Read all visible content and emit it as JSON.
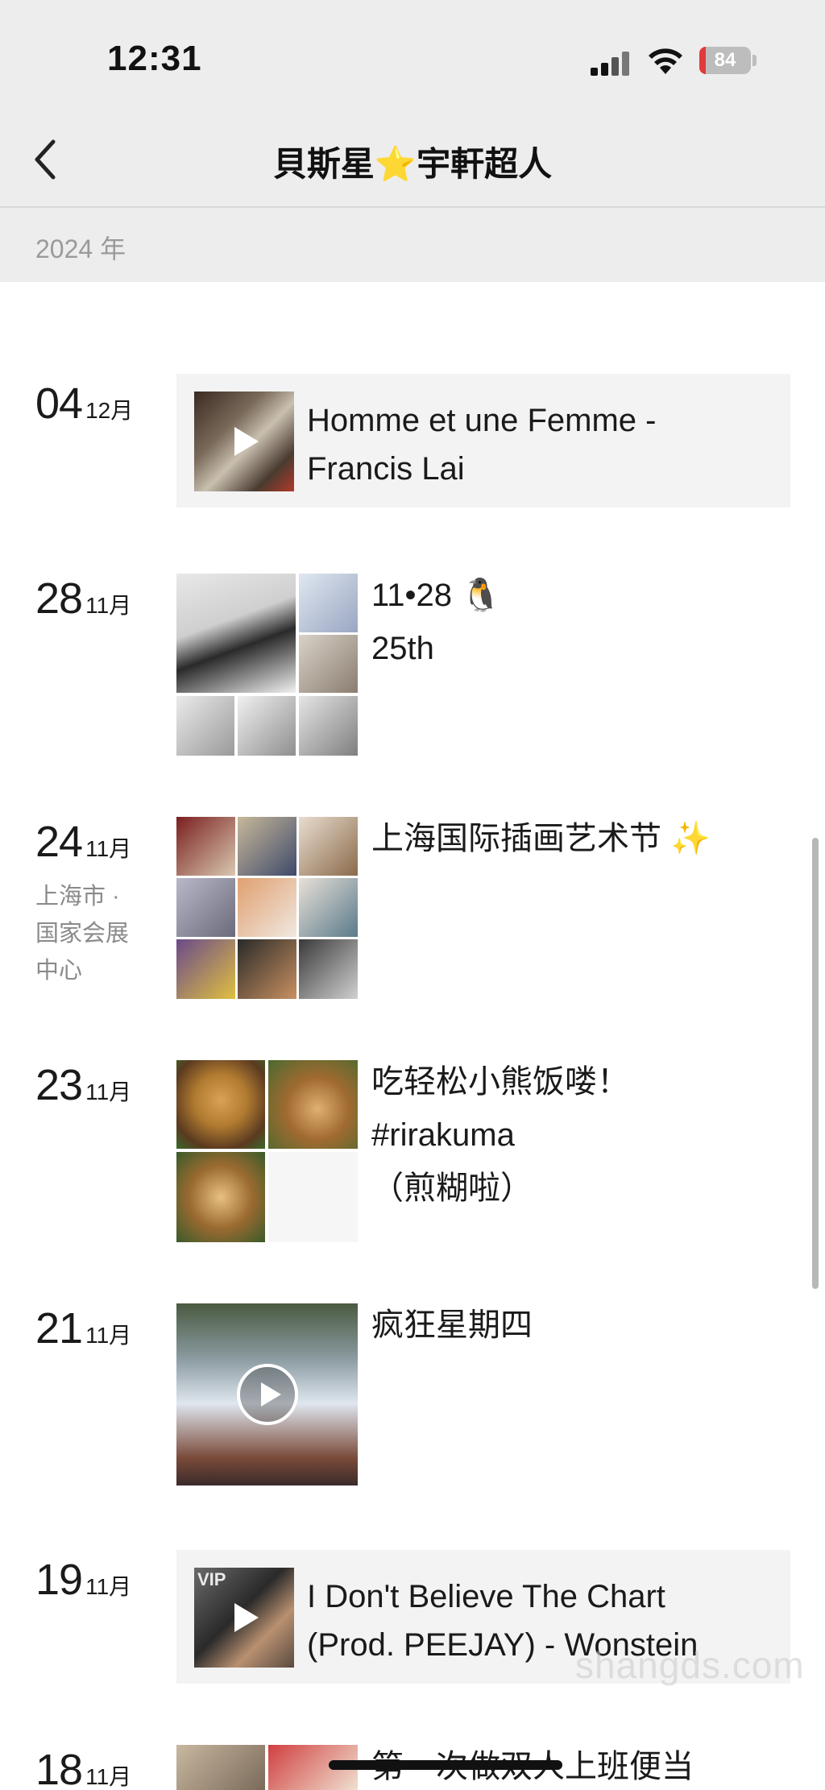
{
  "status_bar": {
    "time": "12:31",
    "battery": "84"
  },
  "nav": {
    "title_left": "貝斯星",
    "title_right": "宇軒超人",
    "title_emoji": "⭐"
  },
  "year_header": "2024 年",
  "posts": [
    {
      "day": "04",
      "month": "12月",
      "type": "music",
      "line1": "Homme et une Femme -",
      "line2": "Francis Lai"
    },
    {
      "day": "28",
      "month": "11月",
      "type": "photos",
      "line1": "11•28 🐧",
      "line2": "25th"
    },
    {
      "day": "24",
      "month": "11月",
      "type": "photos",
      "location": [
        "上海市 ·",
        "国家会展",
        "中心"
      ],
      "line1": "上海国际插画艺术节 ✨"
    },
    {
      "day": "23",
      "month": "11月",
      "type": "photos",
      "line1": "吃轻松小熊饭喽！",
      "line2": "#rirakuma",
      "line3": "（煎糊啦）"
    },
    {
      "day": "21",
      "month": "11月",
      "type": "video",
      "line1": "疯狂星期四"
    },
    {
      "day": "19",
      "month": "11月",
      "type": "music",
      "badge": "VIP",
      "line1": "I Don't Believe The Chart",
      "line2": "(Prod. PEEJAY) - Wonstein"
    },
    {
      "day": "18",
      "month": "11月",
      "type": "photos",
      "line1": "第一次做双人上班便当"
    }
  ],
  "watermark": "shangds.com"
}
